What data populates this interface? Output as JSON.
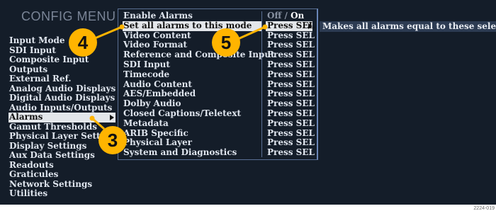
{
  "config_menu": {
    "title": "CONFIG MENU"
  },
  "main_menu": {
    "items": [
      "Input Mode",
      "SDI Input",
      "Composite Input",
      "Outputs",
      "External Ref.",
      "Analog Audio Displays",
      "Digital Audio Displays",
      "Audio Inputs/Outputs",
      "Alarms",
      "Gamut Thresholds",
      "Physical Layer Settings",
      "Display Settings",
      "Aux Data Settings",
      "Readouts",
      "Graticules",
      "Network Settings",
      "Utilities"
    ],
    "selected": "Alarms"
  },
  "alarms_menu": {
    "enable": {
      "label": "Enable Alarms",
      "off": "Off",
      "slash": "/",
      "on": "On"
    },
    "rows": [
      {
        "label": "Set all alarms to this mode",
        "value": "Press SEL"
      },
      {
        "label": "Video Content",
        "value": "Press SEL"
      },
      {
        "label": "Video Format",
        "value": "Press SEL"
      },
      {
        "label": "Reference and Composite Input",
        "value": "Press SEL"
      },
      {
        "label": "SDI Input",
        "value": "Press SEL"
      },
      {
        "label": "Timecode",
        "value": "Press SEL"
      },
      {
        "label": "Audio Content",
        "value": "Press SEL"
      },
      {
        "label": "AES/Embedded",
        "value": "Press SEL"
      },
      {
        "label": "Dolby Audio",
        "value": "Press SEL"
      },
      {
        "label": "Closed Captions/Teletext",
        "value": "Press SEL"
      },
      {
        "label": "Metadata",
        "value": "Press SEL"
      },
      {
        "label": "ARIB Specific",
        "value": "Press SEL"
      },
      {
        "label": "Physical Layer",
        "value": "Press SEL"
      },
      {
        "label": "System and Diagnostics",
        "value": "Press SEL"
      }
    ]
  },
  "help_text": "Makes all alarms equal to these selections",
  "callouts": {
    "c3": "3",
    "c4": "4",
    "c5": "5"
  },
  "figure_id": "2224-019",
  "colors": {
    "callout": "#ffb400",
    "screen_bg": "#141d29",
    "highlight": "#e3e6ea"
  }
}
